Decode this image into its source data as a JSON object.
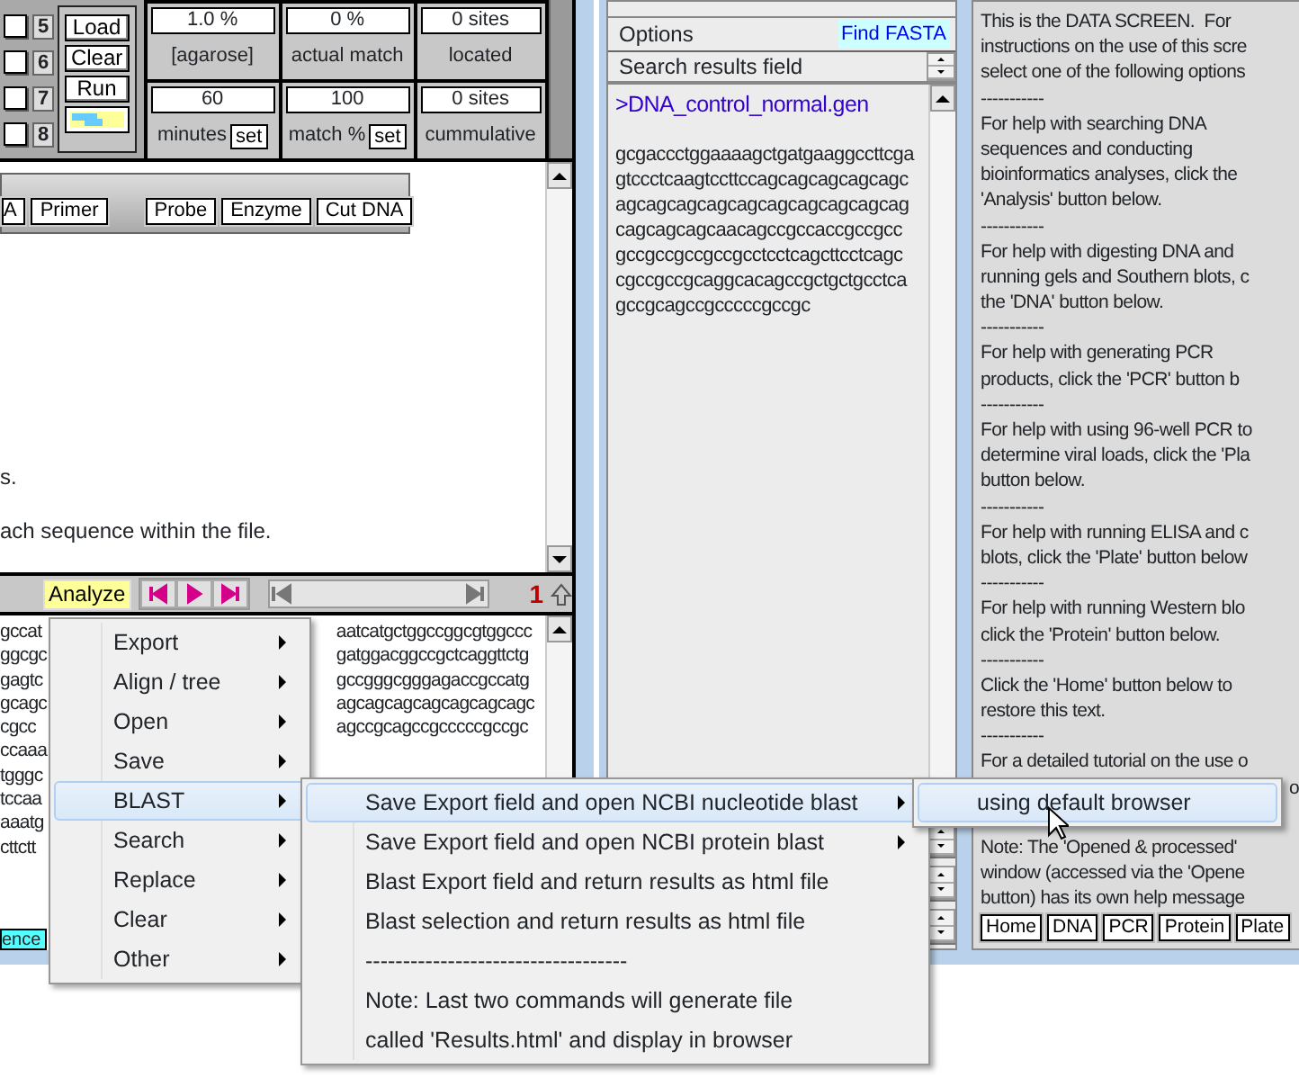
{
  "left_window": {
    "lanes": [
      {
        "number": "5",
        "checked": false
      },
      {
        "number": "6",
        "checked": false
      },
      {
        "number": "7",
        "checked": false
      },
      {
        "number": "8",
        "checked": false
      }
    ],
    "buttons": [
      "Load",
      "Clear",
      "Run"
    ],
    "stats": [
      {
        "value": "1.0 %",
        "label": "[agarose]"
      },
      {
        "value": "0 %",
        "label": "actual match"
      },
      {
        "value": "0 sites",
        "label": "located"
      },
      {
        "value": "60",
        "label": "minutes",
        "set_button": "set"
      },
      {
        "value": "100",
        "label": "match %",
        "set_button": "set"
      },
      {
        "value": "0 sites",
        "label": "cummulative"
      }
    ],
    "toolbar": [
      "A",
      "Primer",
      "Probe",
      "Enzyme",
      "Cut DNA"
    ],
    "text_lines": [
      "s.",
      "ach sequence within the file."
    ],
    "analyze_button": "Analyze",
    "page_number": "1",
    "sequence_left": [
      "gccat",
      "ggcgc",
      "gagtc",
      "gcagc",
      "cgcc",
      "ccaaa",
      "tgggc",
      "tccaa",
      "aaatg",
      "cttctt"
    ],
    "sequence_right": [
      "aatcatgctggccggcgtggccc",
      "gatggacggccgctcaggttctg",
      "gccgggcgggagaccgccatg",
      "agcagcagcagcagcagcagc",
      "agccgcagccgcccccgccgc"
    ],
    "status_field": "ence"
  },
  "middle_window": {
    "options_label": "Options",
    "find_button": "Find FASTA",
    "search_field": "Search results field",
    "file_name": ">DNA_control_normal.gen",
    "sequence": [
      "gcgaccctggaaaagctgatgaaggccttcga",
      "gtccctcaagtccttccagcagcagcagcagc",
      "agcagcagcagcagcagcagcagcagcag",
      "cagcagcagcaacagccgccaccgccgcc",
      "gccgccgccgccgcctcctcagcttcctcagc",
      "cgccgccgcaggcacagccgctgctgcctca",
      "gccgcagccgcccccgccgc"
    ]
  },
  "right_window": {
    "help_lines": [
      "This is the DATA SCREEN.  For",
      "instructions on the use of this scre",
      "select one of the following options",
      "-----------",
      "For help with searching DNA",
      "sequences and conducting",
      "bioinformatics analyses, click the",
      "'Analysis' button below.",
      "-----------",
      "For help with digesting DNA and",
      "running gels and Southern blots, c",
      "the 'DNA' button below.",
      "-----------",
      "For help with generating PCR",
      "products, click the 'PCR' button b",
      "-----------",
      "For help with using 96-well PCR to",
      "determine viral loads, click the 'Pla",
      "button below.",
      "-----------",
      "For help with running ELISA and c",
      "blots, click the 'Plate' button below",
      "-----------",
      "For help with running Western blo",
      "click the 'Protein' button below.",
      "-----------",
      "Click the 'Home' button below to",
      "restore this text.",
      "-----------",
      "For a detailed tutorial on the use o"
    ],
    "covered_line_end": "o",
    "note_lines": [
      "Note: The 'Opened & processed'",
      "window (accessed via the 'Opene",
      "button) has its own help message"
    ],
    "buttons": [
      "Home",
      "DNA",
      "PCR",
      "Protein",
      "Plate"
    ]
  },
  "context_menu": {
    "items": [
      {
        "label": "Export",
        "has_submenu": true,
        "selected": false
      },
      {
        "label": "Align / tree",
        "has_submenu": true,
        "selected": false
      },
      {
        "label": "Open",
        "has_submenu": true,
        "selected": false
      },
      {
        "label": "Save",
        "has_submenu": true,
        "selected": false
      },
      {
        "label": "BLAST",
        "has_submenu": true,
        "selected": true
      },
      {
        "label": "Search",
        "has_submenu": true,
        "selected": false
      },
      {
        "label": "Replace",
        "has_submenu": true,
        "selected": false
      },
      {
        "label": "Clear",
        "has_submenu": true,
        "selected": false
      },
      {
        "label": "Other",
        "has_submenu": true,
        "selected": false
      }
    ]
  },
  "blast_submenu": {
    "items": [
      {
        "label": "Save Export field and open NCBI nucleotide blast",
        "has_submenu": true,
        "selected": true
      },
      {
        "label": "Save  Export field and open NCBI protein blast",
        "has_submenu": true,
        "selected": false
      },
      {
        "label": "Blast Export field and return results as html file",
        "has_submenu": false,
        "selected": false
      },
      {
        "label": "Blast selection and return results as html file",
        "has_submenu": false,
        "selected": false
      },
      {
        "label": "-----------------------------------",
        "has_submenu": false,
        "selected": false
      },
      {
        "label": "Note:  Last two commands will generate file",
        "has_submenu": false,
        "selected": false
      },
      {
        "label": "called 'Results.html' and display in browser",
        "has_submenu": false,
        "selected": false
      }
    ]
  },
  "nucleotide_submenu": {
    "items": [
      {
        "label": "using default browser",
        "has_submenu": false,
        "selected": true
      }
    ]
  }
}
